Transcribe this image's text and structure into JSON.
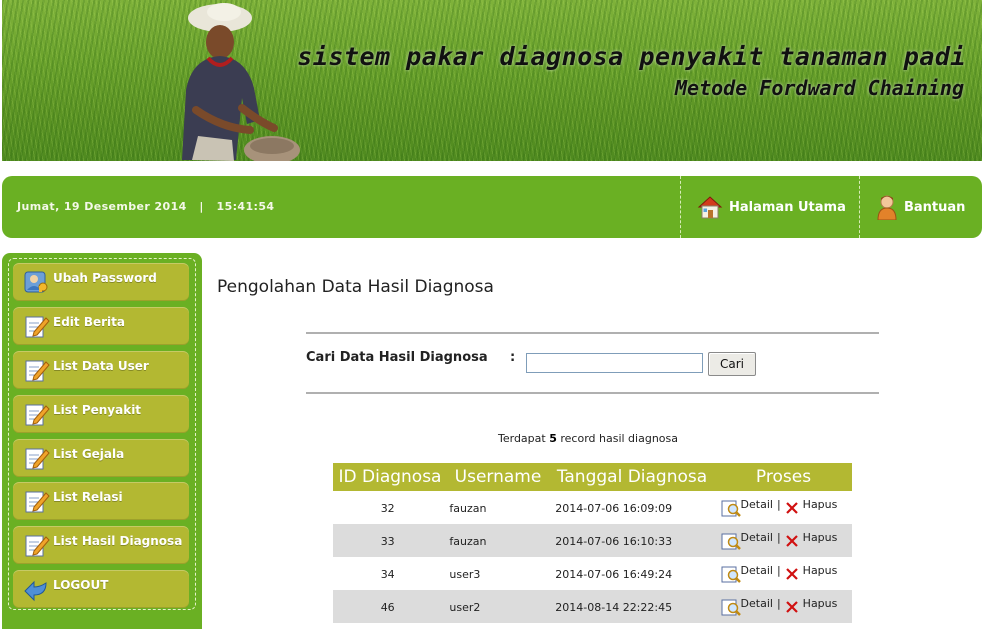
{
  "banner": {
    "title": "sistem pakar diagnosa penyakit tanaman padi",
    "subtitle": "Metode Fordward Chaining"
  },
  "topbar": {
    "date": "Jumat, 19 Desember 2014",
    "separator": "|",
    "time": "15:41:54",
    "nav": [
      {
        "label": "Halaman Utama",
        "icon": "house-icon"
      },
      {
        "label": "Bantuan",
        "icon": "help-person-icon"
      }
    ]
  },
  "sidebar": {
    "items": [
      {
        "label": "Ubah Password",
        "icon": "user-key-icon"
      },
      {
        "label": "Edit Berita",
        "icon": "edit-document-icon"
      },
      {
        "label": "List Data User",
        "icon": "edit-document-icon"
      },
      {
        "label": "List Penyakit",
        "icon": "edit-document-icon"
      },
      {
        "label": "List Gejala",
        "icon": "edit-document-icon"
      },
      {
        "label": "List Relasi",
        "icon": "edit-document-icon"
      },
      {
        "label": "List Hasil Diagnosa",
        "icon": "edit-document-icon"
      },
      {
        "label": "LOGOUT",
        "icon": "logout-arrow-icon"
      }
    ]
  },
  "main": {
    "title": "Pengolahan Data Hasil Diagnosa",
    "search": {
      "label": "Cari Data Hasil Diagnosa",
      "colon": ":",
      "value": "",
      "placeholder": "",
      "button": "Cari"
    },
    "record_count": {
      "prefix": "Terdapat",
      "count": "5",
      "suffix": "record hasil diagnosa"
    },
    "table": {
      "headers": [
        "ID Diagnosa",
        "Username",
        "Tanggal Diagnosa",
        "Proses"
      ],
      "rows": [
        {
          "id": "32",
          "username": "fauzan",
          "date": "2014-07-06 16:09:09"
        },
        {
          "id": "33",
          "username": "fauzan",
          "date": "2014-07-06 16:10:33"
        },
        {
          "id": "34",
          "username": "user3",
          "date": "2014-07-06 16:49:24"
        },
        {
          "id": "46",
          "username": "user2",
          "date": "2014-08-14 22:22:45"
        }
      ],
      "actions": {
        "detail": "Detail",
        "separator": "|",
        "delete": "Hapus"
      }
    }
  },
  "colors": {
    "green": "#6ab023",
    "olive": "#b3b832",
    "row_alt": "#dcdcdc"
  }
}
